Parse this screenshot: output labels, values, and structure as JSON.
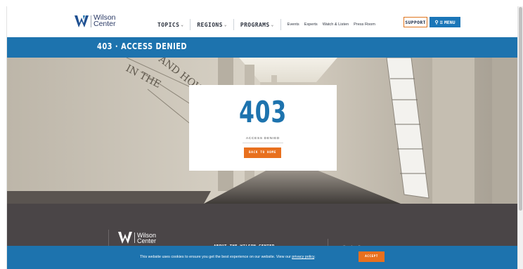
{
  "header": {
    "logo_line1": "Wilson",
    "logo_line2": "Center",
    "nav_main": [
      {
        "label": "TOPICS"
      },
      {
        "label": "REGIONS"
      },
      {
        "label": "PROGRAMS"
      }
    ],
    "nav_links": [
      "Events",
      "Experts",
      "Watch & Listen",
      "Press Room"
    ],
    "support_label": "SUPPORT",
    "menu_label": "MENU"
  },
  "page_title": "403 · ACCESS DENIED",
  "error_card": {
    "code": "403",
    "subtitle": "ACCESS DENIED",
    "button_label": "BACK TO HOME"
  },
  "footer": {
    "logo_line1": "Wilson",
    "logo_line2": "Center",
    "about_heading": "ABOUT THE WILSON CENTER",
    "follow_heading": "Follow the Wilson Center"
  },
  "cookie_banner": {
    "text_before": "This website uses cookies to ensure you get the best experience on our website. View our ",
    "link_text": "privacy policy",
    "text_after": ".",
    "accept_label": "ACCEPT"
  },
  "colors": {
    "brand_blue": "#1d73ae",
    "accent_orange": "#e8701e",
    "footer_bg": "#4a4547"
  }
}
